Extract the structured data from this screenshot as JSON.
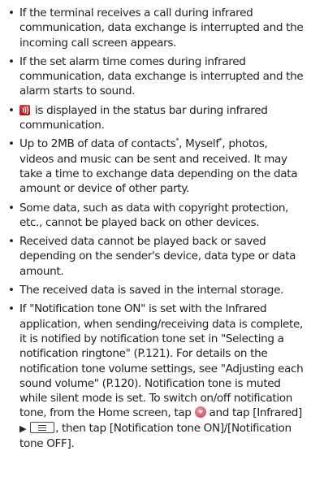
{
  "bullets": [
    {
      "text": "If the terminal receives a call during infrared communication, data exchange is interrupted and the incoming call screen appears."
    },
    {
      "text": "If the set alarm time comes during infrared communication, data exchange is interrupted and the alarm starts to sound."
    },
    {
      "icon": "infrared-status-icon",
      "text": " is displayed in the status bar during infrared communication."
    },
    {
      "text_a": "Up to 2MB of data of contacts",
      "note_a": "*",
      "text_b": ", Myself",
      "note_b": "*",
      "text_c": ", photos, videos and music can be sent and received. It may take a time to exchange data depending on the data amount or device of other party."
    },
    {
      "text": "Some data, such as data with copyright protection, etc., cannot be played back on other devices."
    },
    {
      "text": "Received data cannot be played back or saved depending on the sender's device, data type or data amount."
    },
    {
      "text": "The received data is saved in the internal storage."
    },
    {
      "text_a": "If \"Notification tone ON\" is set with the Infrared application, when sending/receiving data is complete, it is notified by notification tone set in \"Selecting a notification ringtone\" (P.121). For details on the notification tone volume settings, see \"Adjusting each sound volume\" (P.120). Notification tone is muted while silent mode is set. To switch on/off notification tone, from the Home screen, tap ",
      "icon_a": "app-menu-icon",
      "text_b": " and tap [Infrared] ",
      "arrow": "▶",
      "icon_b": "menu-key-icon",
      "text_c": ", then tap [Notification tone ON]/[Notification tone OFF]."
    }
  ],
  "bullet_char": "•"
}
